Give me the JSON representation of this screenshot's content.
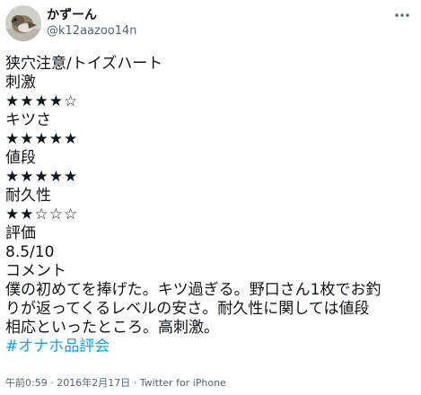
{
  "author": {
    "display_name": "かずーん",
    "handle": "@k12aazoo14n"
  },
  "tweet": {
    "lines": [
      "狭穴注意/トイズハート",
      "刺激",
      "★★★★☆",
      "キツさ",
      "★★★★★",
      "値段",
      "★★★★★",
      "耐久性",
      "★★☆☆☆",
      "評価",
      "8.5/10",
      "コメント",
      "僕の初めてを捧げた。キツ過ぎる。野口さん1枚でお釣",
      "りが返ってくるレベルの安さ。耐久性に関しては値段",
      "相応といったところ。高刺激。"
    ],
    "hashtag": "#オナホ品評会"
  },
  "meta": {
    "time": "午前0:59",
    "separator1": " · ",
    "date": "2016年2月17日",
    "separator2": " · ",
    "source": "Twitter for iPhone"
  },
  "icons": {
    "avatar": "bird-avatar",
    "more": "more-dots-icon"
  },
  "colors": {
    "text": "#0f1419",
    "secondary": "#536471",
    "link": "#1d9bf0"
  }
}
